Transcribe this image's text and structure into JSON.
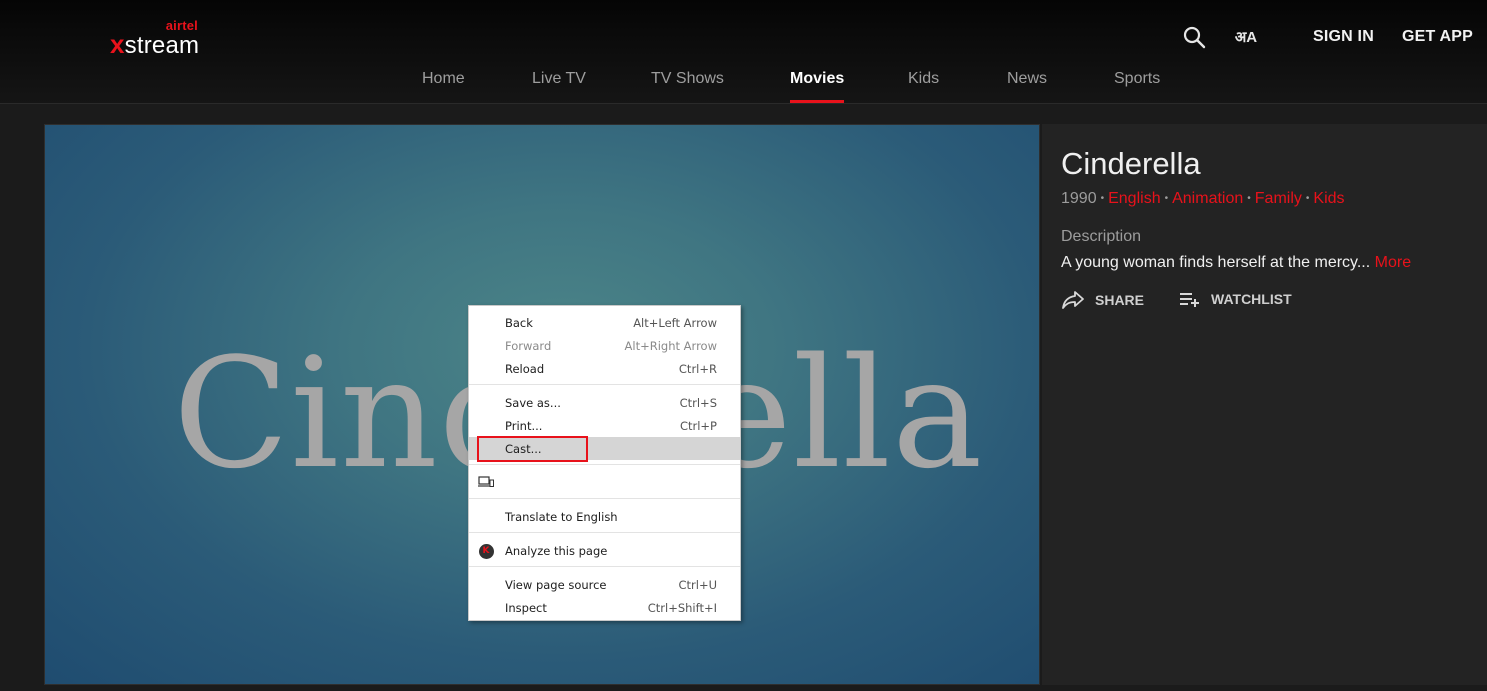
{
  "header": {
    "logo_top": "airtel",
    "logo_x": "x",
    "logo_main": "stream",
    "sign_in": "SIGN IN",
    "get_app": "GET APP",
    "lang_glyph": "अA",
    "accent": "#e8121b"
  },
  "nav": {
    "items": [
      {
        "label": "Home"
      },
      {
        "label": "Live TV"
      },
      {
        "label": "TV Shows"
      },
      {
        "label": "Movies",
        "active": true
      },
      {
        "label": "Kids"
      },
      {
        "label": "News"
      },
      {
        "label": "Sports"
      }
    ]
  },
  "player": {
    "title_art": "Cinderella"
  },
  "details": {
    "title": "Cinderella",
    "year": "1990",
    "tags": [
      "English",
      "Animation",
      "Family",
      "Kids"
    ],
    "separator": "•",
    "description_label": "Description",
    "description": "A young woman finds herself at the mercy...",
    "more": "More",
    "share": "SHARE",
    "watchlist": "WATCHLIST"
  },
  "context_menu": {
    "back": {
      "label": "Back",
      "shortcut": "Alt+Left Arrow"
    },
    "forward": {
      "label": "Forward",
      "shortcut": "Alt+Right Arrow"
    },
    "reload": {
      "label": "Reload",
      "shortcut": "Ctrl+R"
    },
    "save_as": {
      "label": "Save as...",
      "shortcut": "Ctrl+S"
    },
    "print": {
      "label": "Print...",
      "shortcut": "Ctrl+P"
    },
    "cast": {
      "label": "Cast..."
    },
    "translate": {
      "label": "Translate to English"
    },
    "analyze": {
      "label": "Analyze this page",
      "badge": "K"
    },
    "view_source": {
      "label": "View page source",
      "shortcut": "Ctrl+U"
    },
    "inspect": {
      "label": "Inspect",
      "shortcut": "Ctrl+Shift+I"
    }
  }
}
